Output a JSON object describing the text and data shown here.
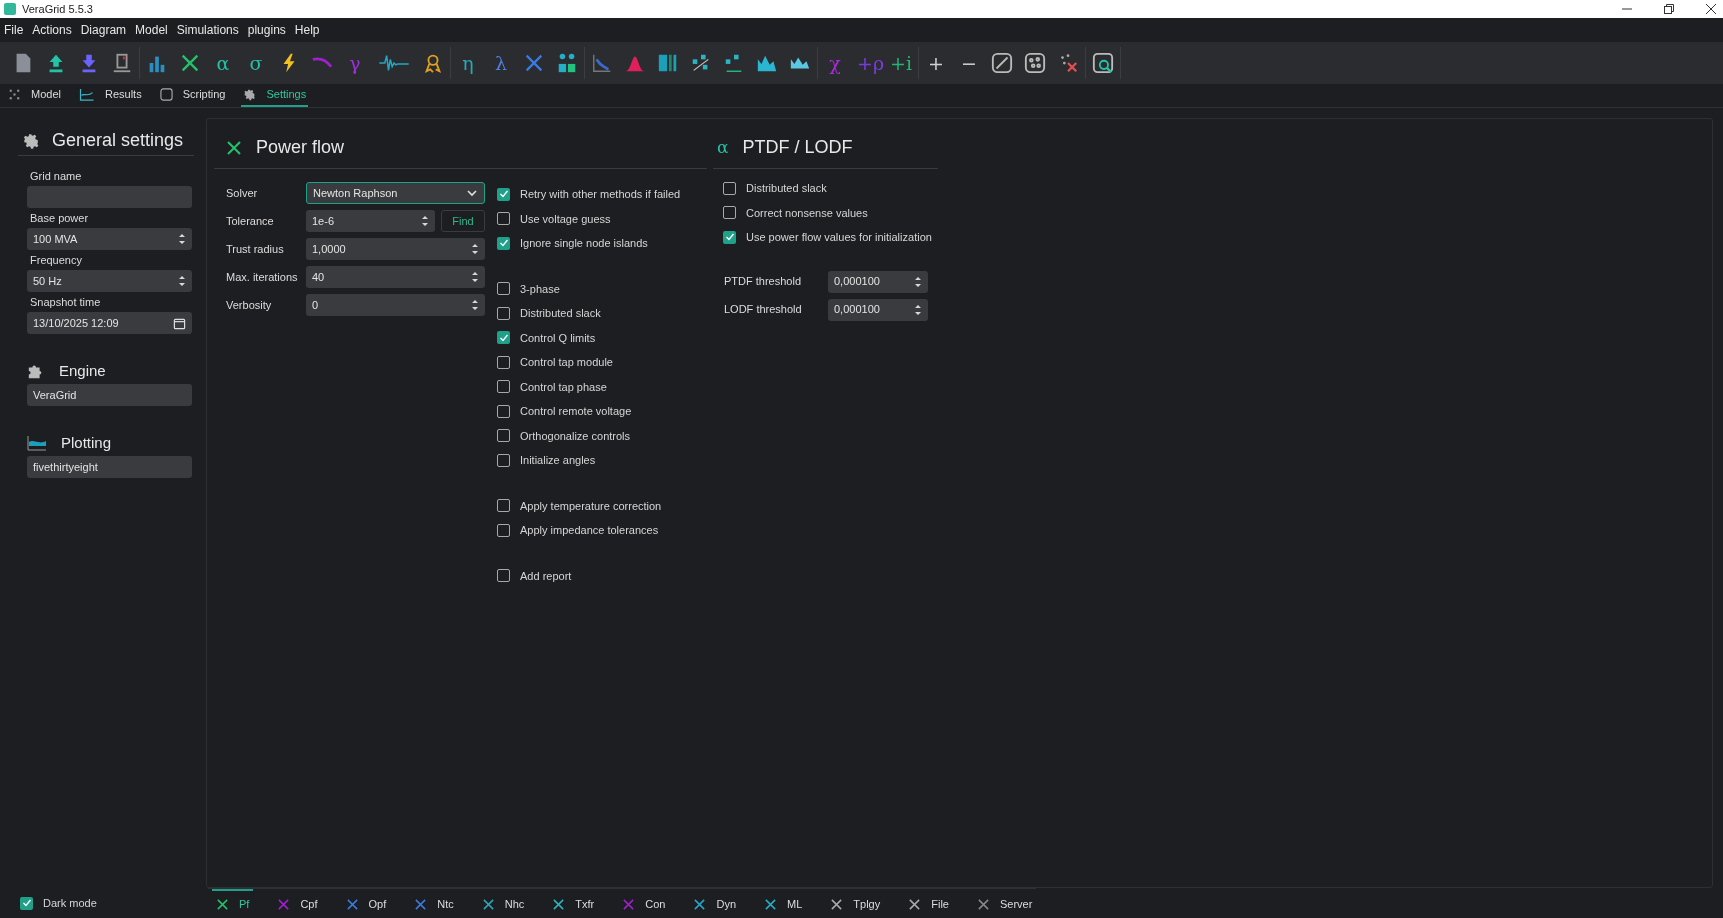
{
  "window": {
    "title": "VeraGrid 5.5.3"
  },
  "menu": [
    "File",
    "Actions",
    "Diagram",
    "Model",
    "Simulations",
    "plugins",
    "Help"
  ],
  "toolbar": [
    [
      {
        "kind": "icon"
      },
      {
        "kind": "icon"
      },
      {
        "kind": "icon"
      },
      {
        "kind": "icon"
      }
    ],
    [
      {
        "kind": "icon"
      },
      {
        "kind": "icon"
      },
      {
        "kind": "glyph",
        "text": "α"
      },
      {
        "kind": "glyph",
        "text": "σ"
      },
      {
        "kind": "icon"
      },
      {
        "kind": "icon"
      },
      {
        "kind": "glyph",
        "text": "γ"
      },
      {
        "kind": "icon"
      },
      {
        "kind": "icon"
      }
    ],
    [
      {
        "kind": "glyph",
        "text": "η"
      },
      {
        "kind": "glyph",
        "text": "λ"
      },
      {
        "kind": "icon"
      },
      {
        "kind": "icon"
      }
    ],
    [
      {
        "kind": "icon"
      },
      {
        "kind": "icon"
      },
      {
        "kind": "icon"
      },
      {
        "kind": "icon"
      },
      {
        "kind": "icon"
      },
      {
        "kind": "icon"
      },
      {
        "kind": "icon"
      }
    ],
    [
      {
        "kind": "glyph",
        "text": "χ"
      },
      {
        "kind": "glyph",
        "text": "+ρ"
      },
      {
        "kind": "glyph",
        "text": "+i"
      }
    ],
    [
      {
        "kind": "glyph",
        "text": "+"
      },
      {
        "kind": "glyph",
        "text": "−"
      },
      {
        "kind": "icon"
      },
      {
        "kind": "icon"
      },
      {
        "kind": "icon"
      }
    ],
    [
      {
        "kind": "icon"
      }
    ]
  ],
  "tabs": [
    {
      "label": "Model",
      "selected": false
    },
    {
      "label": "Results",
      "selected": false
    },
    {
      "label": "Scripting",
      "selected": false
    },
    {
      "label": "Settings",
      "selected": true
    }
  ],
  "general": {
    "title": "General settings",
    "fields": [
      {
        "label": "Grid name",
        "kind": "text"
      },
      {
        "label": "Base power",
        "kind": "spin",
        "value": "100 MVA"
      },
      {
        "label": "Frequency",
        "kind": "spin",
        "value": "50 Hz"
      },
      {
        "label": "Snapshot time",
        "kind": "date",
        "value": "13/10/2025 12:09"
      }
    ],
    "engine": {
      "title": "Engine",
      "value": "VeraGrid"
    },
    "plotting": {
      "title": "Plotting",
      "value": "fivethirtyeight"
    },
    "dark_mode": {
      "label": "Dark mode",
      "checked": true
    }
  },
  "power_flow": {
    "title": "Power flow",
    "fields": [
      {
        "label": "Solver",
        "kind": "combo",
        "value": "Newton Raphson"
      },
      {
        "label": "Tolerance",
        "kind": "spin_find",
        "value": "1e-6",
        "button": "Find"
      },
      {
        "label": "Trust radius",
        "kind": "spin",
        "value": "1,0000"
      },
      {
        "label": "Max. iterations",
        "kind": "spin",
        "value": "40"
      },
      {
        "label": "Verbosity",
        "kind": "spin",
        "value": "0"
      }
    ],
    "option_groups": [
      [
        {
          "label": "Retry with other methods if failed",
          "checked": true
        },
        {
          "label": "Use voltage guess",
          "checked": false
        },
        {
          "label": "Ignore single node islands",
          "checked": true
        }
      ],
      [
        {
          "label": "3-phase",
          "checked": false
        },
        {
          "label": "Distributed slack",
          "checked": false
        },
        {
          "label": "Control Q limits",
          "checked": true
        },
        {
          "label": "Control tap module",
          "checked": false
        },
        {
          "label": "Control tap phase",
          "checked": false
        },
        {
          "label": "Control remote voltage",
          "checked": false
        },
        {
          "label": "Orthogonalize controls",
          "checked": false
        },
        {
          "label": "Initialize angles",
          "checked": false
        }
      ],
      [
        {
          "label": "Apply temperature correction",
          "checked": false
        },
        {
          "label": "Apply impedance tolerances",
          "checked": false
        }
      ],
      [
        {
          "label": "Add report",
          "checked": false
        }
      ]
    ]
  },
  "ptdf": {
    "title": "PTDF / LODF",
    "glyph": "α",
    "options": [
      {
        "label": "Distributed slack",
        "checked": false
      },
      {
        "label": "Correct nonsense values",
        "checked": false
      },
      {
        "label": "Use power flow values for initialization",
        "checked": true
      }
    ],
    "fields": [
      {
        "label": "PTDF threshold",
        "value": "0,000100"
      },
      {
        "label": "LODF threshold",
        "value": "0,000100"
      }
    ]
  },
  "bottom_tabs": [
    {
      "label": "Pf",
      "selected": true
    },
    {
      "label": "Cpf",
      "selected": false
    },
    {
      "label": "Opf",
      "selected": false
    },
    {
      "label": "Ntc",
      "selected": false
    },
    {
      "label": "Nhc",
      "selected": false
    },
    {
      "label": "Txfr",
      "selected": false
    },
    {
      "label": "Con",
      "selected": false
    },
    {
      "label": "Dyn",
      "selected": false
    },
    {
      "label": "ML",
      "selected": false
    },
    {
      "label": "Tplgy",
      "selected": false
    },
    {
      "label": "File",
      "selected": false
    },
    {
      "label": "Server",
      "selected": false
    }
  ]
}
